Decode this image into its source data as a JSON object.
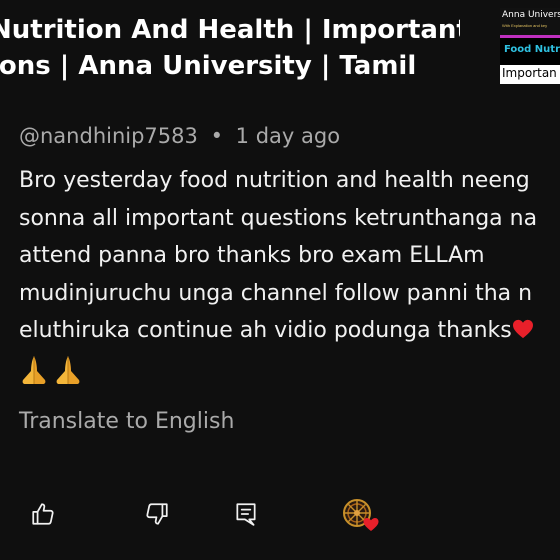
{
  "video": {
    "title_line1": "Nutrition And Health | Important",
    "title_line2": "ions | Anna University | Tamil",
    "thumbnail": {
      "line1": "Anna University",
      "line2": "With Explanation and key",
      "line3": "Food Nutri",
      "line4": "Importan"
    }
  },
  "comment": {
    "author": "@nandhinip7583",
    "separator": "•",
    "time": "1 day ago",
    "lines": [
      "Bro yesterday food nutrition and health neeng",
      "sonna all important questions ketrunthanga na",
      "attend panna bro thanks bro exam ELLAm",
      "mudinjuruchu unga channel follow panni tha n",
      "eluthiruka continue ah vidio podunga thanks"
    ],
    "translate_label": "Translate to English"
  },
  "icons": {
    "like": "thumbs-up-icon",
    "dislike": "thumbs-down-icon",
    "reply": "reply-comment-icon",
    "hearted": "creator-heart-avatar-icon",
    "heart_emoji": "red-heart-emoji",
    "hands_emoji": "folded-hands-emoji"
  },
  "colors": {
    "background": "#0f0f0f",
    "text": "#f1f1f1",
    "secondary_text": "#aaaaaa",
    "heart": "#e8202a"
  }
}
